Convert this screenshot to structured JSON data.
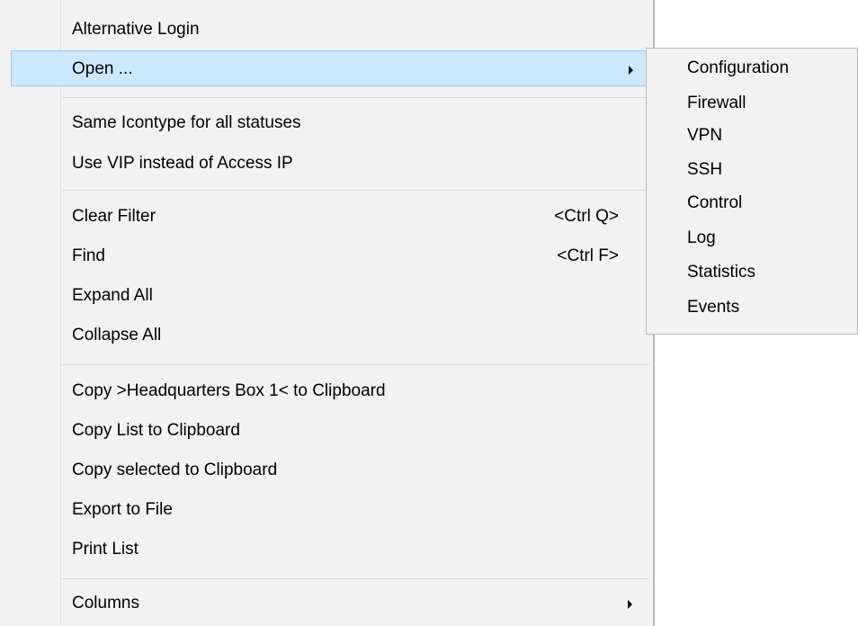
{
  "menu": {
    "alternative_login": "Alternative Login",
    "open": "Open ...",
    "same_icontype": "Same Icontype for all statuses",
    "use_vip": "Use VIP instead of Access IP",
    "clear_filter": "Clear Filter",
    "clear_filter_shortcut": "<Ctrl Q>",
    "find": "Find",
    "find_shortcut": "<Ctrl F>",
    "expand_all": "Expand All",
    "collapse_all": "Collapse All",
    "copy_headquarters": "Copy >Headquarters Box 1< to Clipboard",
    "copy_list": "Copy List to Clipboard",
    "copy_selected": "Copy selected to Clipboard",
    "export_file": "Export to File",
    "print_list": "Print List",
    "columns": "Columns"
  },
  "submenu": {
    "items": [
      "Configuration",
      "Firewall",
      "VPN",
      "SSH",
      "Control",
      "Log",
      "Statistics",
      "Events"
    ]
  },
  "colors": {
    "menu_bg": "#f2f2f2",
    "hover_bg": "#cce8ff",
    "hover_border": "#99c9ef"
  }
}
